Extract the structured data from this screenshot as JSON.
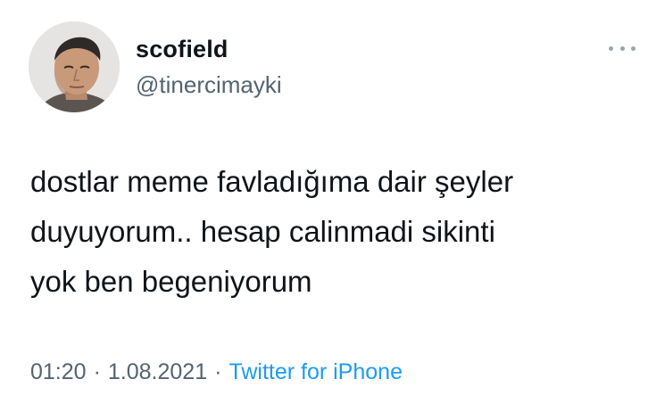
{
  "user": {
    "display_name": "scofield",
    "handle": "@tinercimayki",
    "avatar_icon": "profile-photo"
  },
  "tweet": {
    "text": "dostlar meme favladığıma dair şeyler\nduyuyorum.. hesap calinmadi sikinti\nyok ben begeniyorum",
    "time": "01:20",
    "date": "1.08.2021",
    "separator": "·",
    "source": "Twitter for iPhone"
  },
  "icons": {
    "more": "more-options-icon"
  },
  "colors": {
    "text": "#0f1419",
    "secondary": "#536471",
    "link": "#1d9bf0"
  }
}
